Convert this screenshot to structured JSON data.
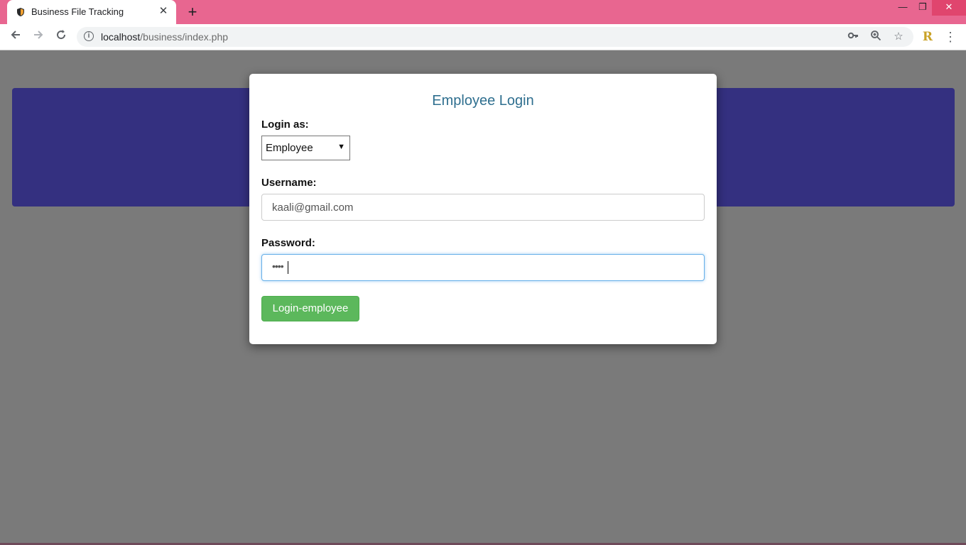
{
  "browser": {
    "tab_title": "Business File Tracking",
    "url_host": "localhost",
    "url_path": "/business/index.php",
    "icons": {
      "back": "back-arrow-icon",
      "forward": "forward-arrow-icon",
      "reload": "reload-icon",
      "info": "info-icon",
      "key": "key-icon",
      "zoom": "zoom-icon",
      "star": "bookmark-star-icon",
      "extension": "extension-r-icon",
      "menu": "kebab-menu-icon"
    },
    "extension_letter": "R",
    "colors": {
      "tabstrip": "#e86690",
      "close_button": "#e0456e"
    }
  },
  "page": {
    "banner_color": "#343080",
    "modal": {
      "title": "Employee Login",
      "login_as_label": "Login as:",
      "login_as_value": "Employee",
      "username_label": "Username:",
      "username_value": "kaali@gmail.com",
      "password_label": "Password:",
      "password_masked": "••••",
      "submit_label": "Login-employee",
      "submit_color": "#5cb85c"
    }
  }
}
